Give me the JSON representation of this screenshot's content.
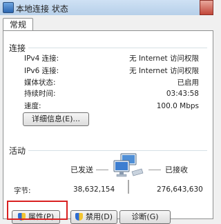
{
  "window": {
    "title": "本地连接 状态"
  },
  "tabs": [
    {
      "label": "常规"
    }
  ],
  "connection": {
    "section_label": "连接",
    "rows": [
      {
        "label": "IPv4 连接:",
        "value": "无 Internet 访问权限"
      },
      {
        "label": "IPv6 连接:",
        "value": "无 Internet 访问权限"
      },
      {
        "label": "媒体状态:",
        "value": "已启用"
      },
      {
        "label": "持续时间:",
        "value": "03:43:58"
      },
      {
        "label": "速度:",
        "value": "100.0 Mbps"
      }
    ],
    "details_button": "详细信息(E)..."
  },
  "activity": {
    "section_label": "活动",
    "sent_label": "已发送",
    "received_label": "已接收",
    "bytes_label": "字节:",
    "sent_bytes": "38,632,154",
    "received_bytes": "276,643,630",
    "icon": "network-computers-icon"
  },
  "buttons": {
    "properties": "属性(P)",
    "disable": "禁用(D)",
    "diagnose": "诊断(G)"
  },
  "colors": {
    "highlight_box": "#d92020",
    "title_bar": "#cfe1f4"
  }
}
